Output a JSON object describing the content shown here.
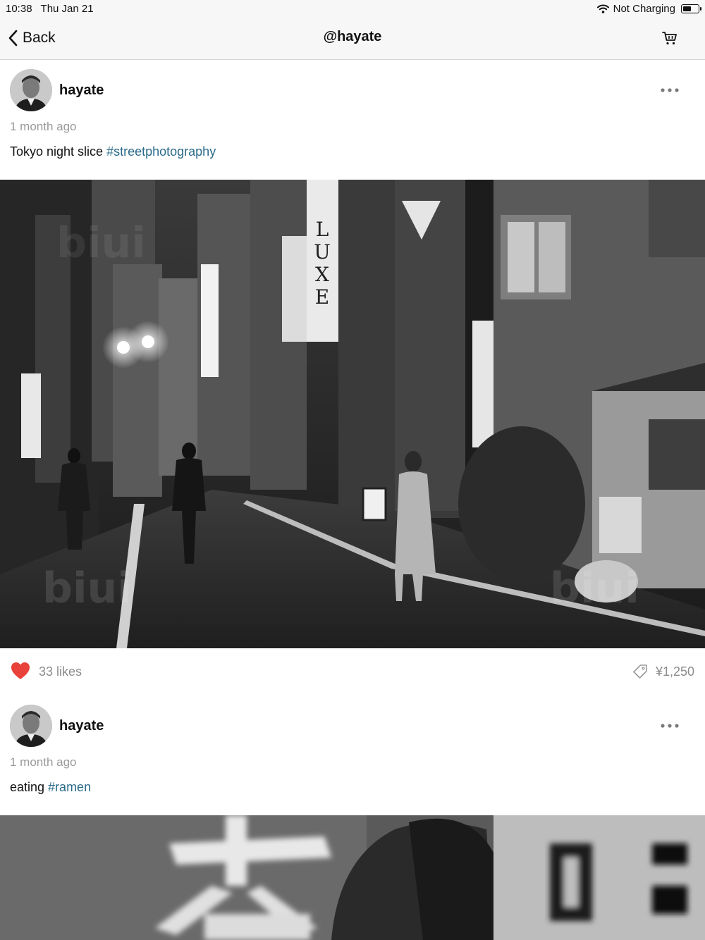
{
  "status_bar": {
    "time": "10:38",
    "date": "Thu Jan 21",
    "charging": "Not Charging"
  },
  "nav": {
    "back_label": "Back",
    "title": "@hayate"
  },
  "posts": [
    {
      "username": "hayate",
      "timestamp": "1 month ago",
      "caption_text": "Tokyo night slice ",
      "hashtag": "#streetphotography",
      "likes": "33 likes",
      "price": "¥1,250"
    },
    {
      "username": "hayate",
      "timestamp": "1 month ago",
      "caption_text": "eating ",
      "hashtag": "#ramen"
    }
  ],
  "colors": {
    "heart": "#e8423a",
    "hashtag": "#2a6a8a",
    "muted_text": "#9a9a9a"
  },
  "icons": {
    "back": "chevron-left-icon",
    "cart": "cart-icon",
    "more": "ellipsis-icon",
    "like": "heart-icon",
    "price": "tag-icon",
    "wifi": "wifi-icon",
    "battery": "battery-icon"
  }
}
